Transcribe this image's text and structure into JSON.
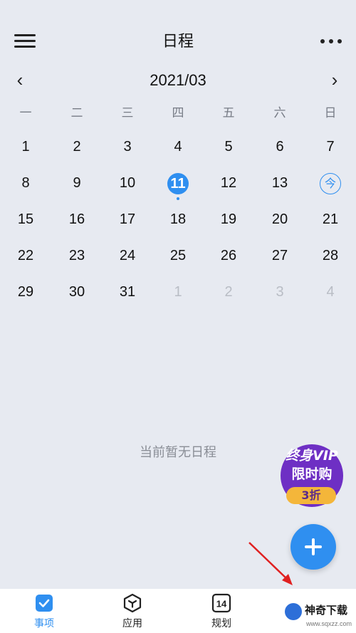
{
  "header": {
    "title": "日程",
    "month": "2021/03",
    "prev_icon": "chevron-left-icon",
    "next_icon": "chevron-right-icon",
    "menu_icon": "hamburger-menu-icon",
    "more_icon": "more-dots-icon"
  },
  "weekdays": [
    "一",
    "二",
    "三",
    "四",
    "五",
    "六",
    "日"
  ],
  "calendar": {
    "weeks": [
      [
        "1",
        "2",
        "3",
        "4",
        "5",
        "6",
        "7"
      ],
      [
        "8",
        "9",
        "10",
        "11",
        "12",
        "13",
        "今"
      ],
      [
        "15",
        "16",
        "17",
        "18",
        "19",
        "20",
        "21"
      ],
      [
        "22",
        "23",
        "24",
        "25",
        "26",
        "27",
        "28"
      ],
      [
        "29",
        "30",
        "31",
        "1",
        "2",
        "3",
        "4"
      ]
    ],
    "selected_day": "11",
    "today_label": "今",
    "next_month_days": [
      "1",
      "2",
      "3",
      "4"
    ]
  },
  "empty_state": {
    "text": "当前暂无日程"
  },
  "promo": {
    "line1": "终身VIP",
    "line2": "限时购",
    "line3": "3折"
  },
  "fab": {
    "icon": "plus-icon"
  },
  "bottom_nav": [
    {
      "label": "事项",
      "icon": "checkbox-icon",
      "active": true
    },
    {
      "label": "应用",
      "icon": "cube-icon",
      "active": false
    },
    {
      "label": "规划",
      "icon": "calendar-14-icon",
      "active": false
    }
  ],
  "watermark": {
    "title": "神奇下载",
    "url": "www.sqxzz.com"
  },
  "colors": {
    "background": "#e7eaf1",
    "accent": "#2f8ff0",
    "muted_text": "#b9bdc5",
    "promo_purple": "#6e2fc4",
    "promo_gold": "#f4b63a",
    "arrow_red": "#e02020"
  }
}
